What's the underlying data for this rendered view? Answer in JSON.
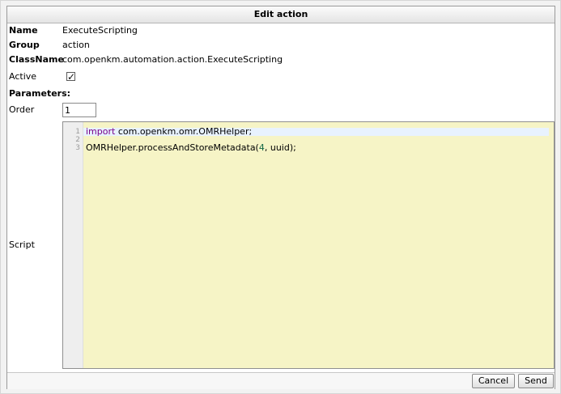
{
  "dialog": {
    "title": "Edit action",
    "fields": {
      "name_label": "Name",
      "name_value": "ExecuteScripting",
      "group_label": "Group",
      "group_value": "action",
      "classname_label": "ClassName",
      "classname_value": "com.openkm.automation.action.ExecuteScripting",
      "active_label": "Active",
      "active_checked": true,
      "active_check_glyph": "✓"
    },
    "parameters_label": "Parameters:",
    "order_label": "Order",
    "order_value": "1",
    "script_label": "Script",
    "script": {
      "line_numbers": [
        "1",
        "2",
        "3"
      ],
      "line1_keyword": "import",
      "line1_rest": " com.openkm.omr.OMRHelper;",
      "line3_prefix": "OMRHelper.processAndStoreMetadata(",
      "line3_number": "4",
      "line3_suffix": ", uuid);"
    },
    "buttons": {
      "cancel": "Cancel",
      "send": "Send"
    }
  }
}
